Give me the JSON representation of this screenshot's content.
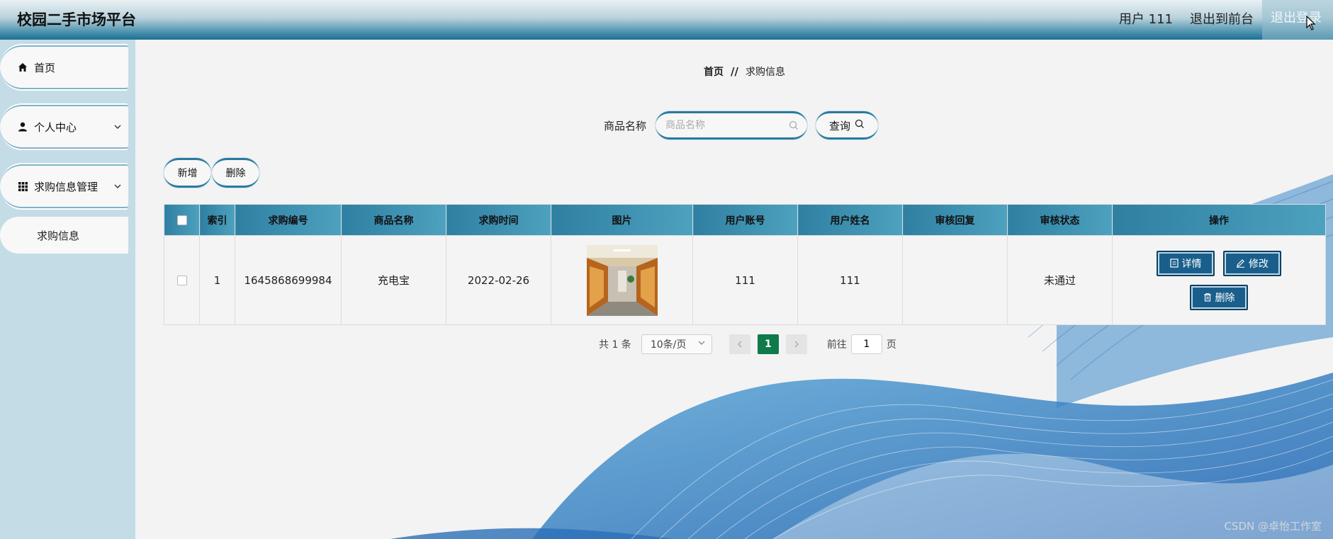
{
  "header": {
    "title": "校园二手市场平台",
    "user_label": "用户 111",
    "back_label": "退出到前台",
    "logout_label": "退出登录"
  },
  "sidebar": {
    "items": [
      {
        "label": "首页",
        "icon": "home-icon"
      },
      {
        "label": "个人中心",
        "icon": "user-icon"
      },
      {
        "label": "求购信息管理",
        "icon": "grid-icon"
      }
    ],
    "sub_item": "求购信息"
  },
  "breadcrumb": {
    "home": "首页",
    "separator": "//",
    "current": "求购信息"
  },
  "search": {
    "label": "商品名称",
    "placeholder": "商品名称",
    "value": "",
    "query_label": "查询"
  },
  "actions": {
    "add_label": "新增",
    "delete_label": "删除"
  },
  "table": {
    "columns": [
      "索引",
      "求购编号",
      "商品名称",
      "求购时间",
      "图片",
      "用户账号",
      "用户姓名",
      "审核回复",
      "审核状态",
      "操作"
    ],
    "rows": [
      {
        "index": "1",
        "order_no": "1645868699984",
        "product": "充电宝",
        "time": "2022-02-26",
        "account": "111",
        "name": "111",
        "reply": "",
        "status": "未通过"
      }
    ],
    "row_actions": {
      "detail": "详情",
      "edit": "修改",
      "delete": "删除"
    }
  },
  "pagination": {
    "total_text": "共 1 条",
    "page_size": "10条/页",
    "current_page": "1",
    "goto_label": "前往",
    "goto_value": "1",
    "page_suffix": "页"
  },
  "watermark": "CSDN @卓怡工作室",
  "colors": {
    "accent": "#2a7aa0",
    "header_dark": "#1f6f93",
    "action_btn": "#1a5f8c",
    "page_active": "#0f7a4a"
  }
}
